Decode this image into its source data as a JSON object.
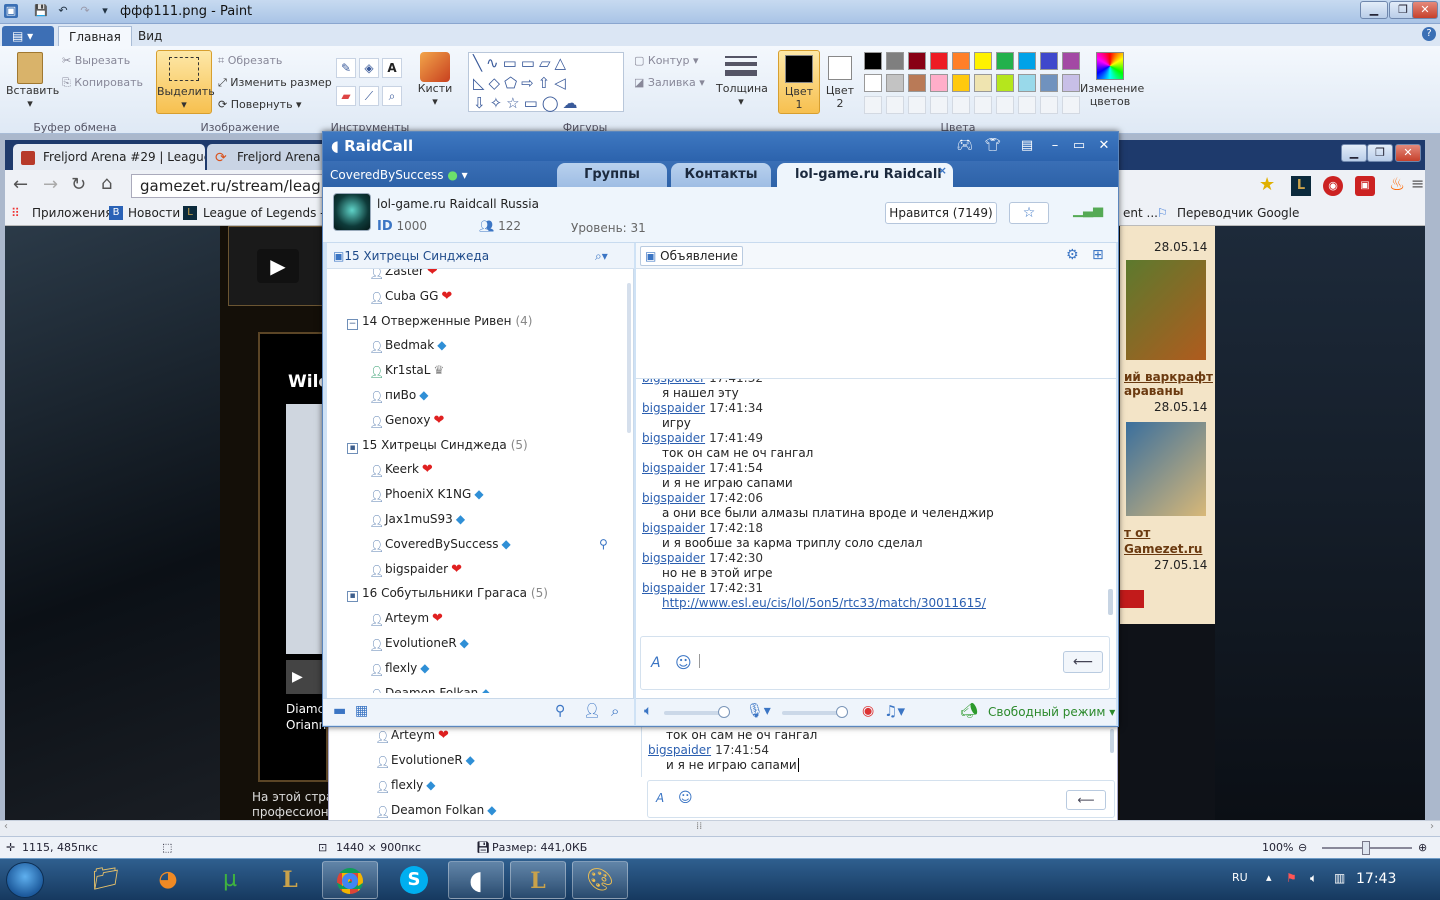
{
  "paint": {
    "title": "ффф111.png - Paint",
    "tabs": {
      "home": "Главная",
      "view": "Вид"
    },
    "clipboard": {
      "paste": "Вставить",
      "cut": "Вырезать",
      "copy": "Копировать",
      "group": "Буфер обмена"
    },
    "image": {
      "select": "Выделить",
      "crop": "Обрезать",
      "resize": "Изменить размер",
      "rotate": "Повернуть",
      "group": "Изображение"
    },
    "tools": {
      "group": "Инструменты"
    },
    "brushes": "Кисти",
    "shapes": {
      "outline": "Контур",
      "fill": "Заливка",
      "group": "Фигуры"
    },
    "thickness": "Толщина",
    "color1": {
      "line1": "Цвет",
      "line2": "1"
    },
    "color2": {
      "line1": "Цвет",
      "line2": "2"
    },
    "edit_colors": {
      "line1": "Изменение",
      "line2": "цветов"
    },
    "colors_group": "Цвета",
    "palette": [
      "#000000",
      "#7f7f7f",
      "#880015",
      "#ed1c24",
      "#ff7f27",
      "#fff200",
      "#22b14c",
      "#00a2e8",
      "#3f48cc",
      "#a349a4",
      "#ffffff",
      "#c3c3c3",
      "#b97a57",
      "#ffaec9",
      "#ffc90e",
      "#efe4b0",
      "#b5e61d",
      "#99d9ea",
      "#7092be",
      "#c8bfe7"
    ],
    "status": {
      "cursor": "1115, 485пкс",
      "dimensions": "1440 × 900пкс",
      "size": "Размер: 441,0КБ",
      "zoom": "100%"
    }
  },
  "chrome": {
    "tabs": [
      "Freljord Arena #29 | League",
      "Freljord Arena #29"
    ],
    "address": "gamezet.ru/stream/leag",
    "bookmarks": {
      "apps": "Приложения",
      "news": "Новости",
      "lol": "League of Legends - P...",
      "translate": "Переводчик Google",
      "ent": "ent ..."
    },
    "site": {
      "date1": "28.05.14",
      "article1_line1": "ий варкрафт",
      "article1_line2": "араваны",
      "date2": "28.05.14",
      "article2_line1": "т от",
      "article2_line2": "Gamezet.ru",
      "date3": "27.05.14",
      "wild": "Wilc",
      "footer_line1": "На этой стран",
      "footer_line2": "профессиона",
      "diam_line1": "Diamc",
      "diam_line2": "Oriann"
    }
  },
  "raidcall": {
    "app_name": "RaidCall",
    "user": "CoveredBySuccess",
    "tabs": {
      "groups": "Группы",
      "contacts": "Контакты",
      "active": "lol-game.ru Raidcall R..."
    },
    "group": {
      "name": "lol-game.ru Raidcall Russia",
      "id_label": "ID",
      "id": "1000",
      "members": "122",
      "level": "Уровень: 31",
      "like": "Нравится (7149)"
    },
    "channel_header": "15 Хитрецы Синджеда",
    "tree": [
      {
        "type": "user",
        "name": "Zaster",
        "badge": "heart"
      },
      {
        "type": "user",
        "name": "Cuba GG",
        "badge": "heart"
      },
      {
        "type": "channel",
        "name": "14 Отверженные Ривен",
        "count": "(4)"
      },
      {
        "type": "user",
        "name": "Bedmak",
        "badge": "gem"
      },
      {
        "type": "user",
        "name": "Kr1staL",
        "badge": "crown"
      },
      {
        "type": "user",
        "name": "пиВо",
        "badge": "gem"
      },
      {
        "type": "user",
        "name": "Genoxy",
        "badge": "heart"
      },
      {
        "type": "channel",
        "name": "15 Хитрецы Синджеда",
        "count": "(5)"
      },
      {
        "type": "user",
        "name": "Keerk",
        "badge": "heart"
      },
      {
        "type": "user",
        "name": "PhoeniX K1NG",
        "badge": "gem"
      },
      {
        "type": "user",
        "name": "Jax1muS93",
        "badge": "gem"
      },
      {
        "type": "user",
        "name": "CoveredBySuccess",
        "badge": "gem"
      },
      {
        "type": "user",
        "name": "bigspaider",
        "badge": "heart"
      },
      {
        "type": "channel",
        "name": "16 Собутыльники Грагаса",
        "count": "(5)"
      },
      {
        "type": "user",
        "name": "Arteym",
        "badge": "heart"
      },
      {
        "type": "user",
        "name": "EvolutioneR",
        "badge": "gem"
      },
      {
        "type": "user",
        "name": "flexly",
        "badge": "gem"
      },
      {
        "type": "user",
        "name": "Deamon Folkan",
        "badge": "gem"
      }
    ],
    "announce_label": "Объявление",
    "chat": [
      {
        "nick": "bigspaider",
        "time": "17:41:32",
        "msg": "я нашел эту"
      },
      {
        "nick": "bigspaider",
        "time": "17:41:34",
        "msg": "игру"
      },
      {
        "nick": "bigspaider",
        "time": "17:41:49",
        "msg": "ток он сам не оч гангал"
      },
      {
        "nick": "bigspaider",
        "time": "17:41:54",
        "msg": "и я не играю сапами"
      },
      {
        "nick": "bigspaider",
        "time": "17:42:06",
        "msg": "а они все были алмазы платина вроде и челенджир"
      },
      {
        "nick": "bigspaider",
        "time": "17:42:18",
        "msg": "и я вообше за карма триплу соло сделал"
      },
      {
        "nick": "bigspaider",
        "time": "17:42:30",
        "msg": "но не в этой игре"
      },
      {
        "nick": "bigspaider",
        "time": "17:42:31",
        "link": "http://www.esl.eu/cis/lol/5on5/rtc33/match/30011615/"
      }
    ],
    "mode": "Свободный режим",
    "send_icon": "⟵"
  },
  "raidcall_bg": {
    "users": [
      {
        "name": "Arteym",
        "badge": "heart"
      },
      {
        "name": "EvolutioneR",
        "badge": "gem"
      },
      {
        "name": "flexly",
        "badge": "gem"
      },
      {
        "name": "Deamon Folkan",
        "badge": "gem"
      }
    ],
    "chat": [
      {
        "msg": "ток он сам не оч гангал"
      },
      {
        "nick": "bigspaider",
        "time": "17:41:54"
      },
      {
        "msg": "и я не играю сапами"
      }
    ]
  },
  "taskbar": {
    "lang": "RU",
    "time": "17:43"
  }
}
